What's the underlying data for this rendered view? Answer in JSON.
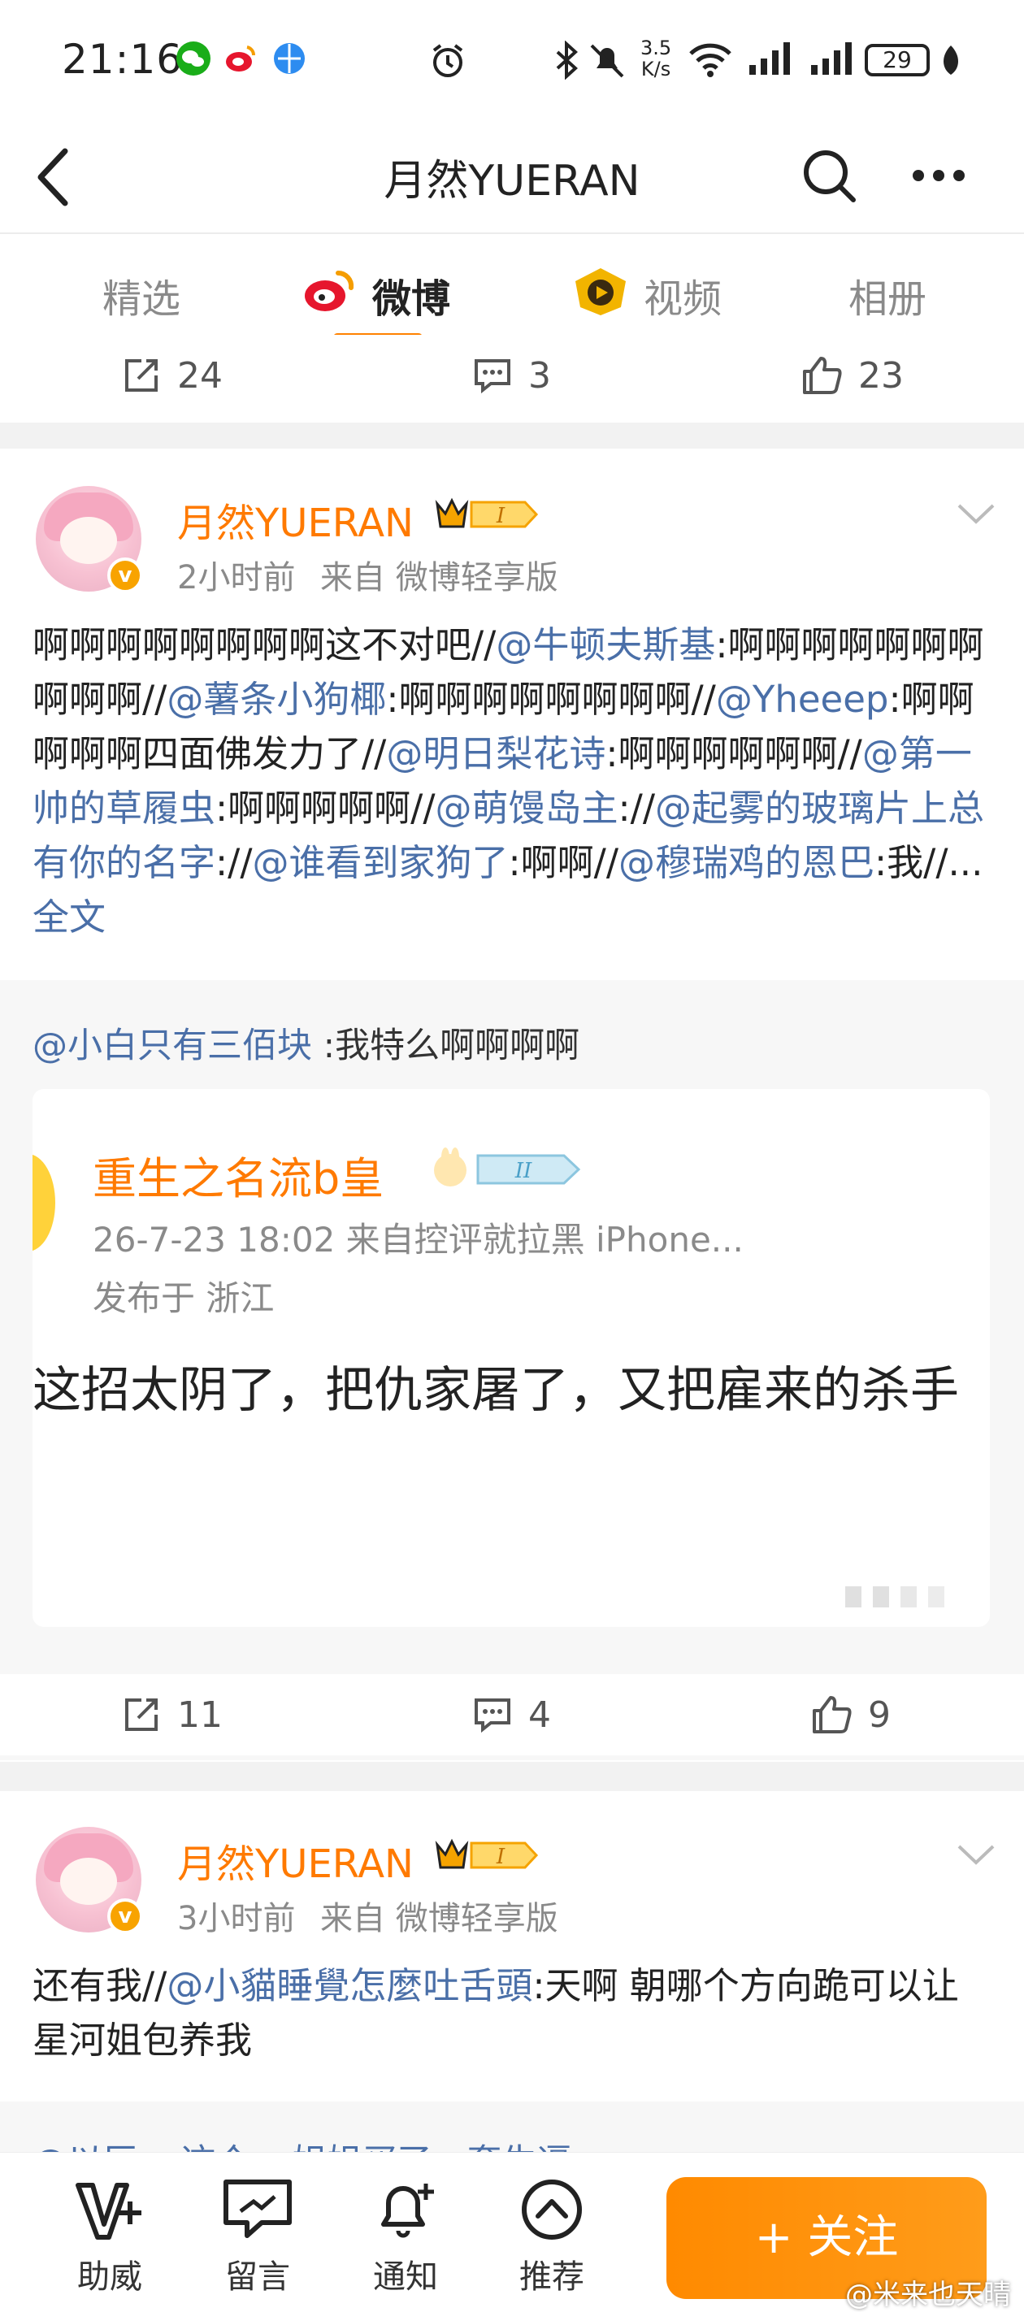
{
  "status": {
    "time": "21:16",
    "net_speed_top": "3.5",
    "net_speed_bottom": "K/s",
    "battery": "29"
  },
  "nav": {
    "title": "月然YUERAN"
  },
  "tabs": [
    {
      "label": "精选"
    },
    {
      "label": "微博"
    },
    {
      "label": "视频"
    },
    {
      "label": "相册"
    }
  ],
  "top_actions": {
    "repost": "24",
    "comment": "3",
    "like": "23"
  },
  "post1": {
    "author": "月然YUERAN",
    "level": "I",
    "time": "2小时前",
    "source": "来自 微博轻享版",
    "text_segments": [
      {
        "t": "啊啊啊啊啊啊啊啊这不对吧//",
        "link": false
      },
      {
        "t": "@牛顿夫斯基",
        "link": true
      },
      {
        "t": ":啊啊啊啊啊啊啊啊啊啊//",
        "link": false
      },
      {
        "t": "@薯条小狗椰",
        "link": true
      },
      {
        "t": ":啊啊啊啊啊啊啊啊//",
        "link": false
      },
      {
        "t": "@Yheeep",
        "link": true
      },
      {
        "t": ":啊啊啊啊啊四面佛发力了//",
        "link": false
      },
      {
        "t": "@明日梨花诗",
        "link": true
      },
      {
        "t": ":啊啊啊啊啊啊//",
        "link": false
      },
      {
        "t": "@第一帅的草履虫",
        "link": true
      },
      {
        "t": ":啊啊啊啊啊//",
        "link": false
      },
      {
        "t": "@萌馒岛主",
        "link": true
      },
      {
        "t": "://",
        "link": false
      },
      {
        "t": "@起雾的玻璃片上总有你的名字",
        "link": true
      },
      {
        "t": "://",
        "link": false
      },
      {
        "t": "@谁看到家狗了",
        "link": true
      },
      {
        "t": ":啊啊//",
        "link": false
      },
      {
        "t": "@穆瑞鸡的恩巴",
        "link": true
      },
      {
        "t": ":我//... ",
        "link": false
      },
      {
        "t": "全文",
        "link": true
      }
    ],
    "repost_user": "@小白只有三佰块",
    "repost_text": " :我特么啊啊啊啊",
    "card": {
      "name": "重生之名流b皇",
      "level": "II",
      "meta": "26-7-23 18:02  来自控评就拉黑 iPhone...",
      "location": "发布于 浙江",
      "quote": "这招太阴了，把仇家屠了，又把雇来的杀手"
    },
    "actions": {
      "repost": "11",
      "comment": "4",
      "like": "9"
    }
  },
  "post2": {
    "author": "月然YUERAN",
    "level": "I",
    "time": "3小时前",
    "source": "来自 微博轻享版",
    "text_segments": [
      {
        "t": "还有我//",
        "link": false
      },
      {
        "t": "@小貓睡覺怎麼吐舌頭",
        "link": true
      },
      {
        "t": ":天啊 朝哪个方向跪可以让星河姐包养我",
        "link": false
      }
    ],
    "repost_peek": "@以辰v :这个cp姐姐买了一套生逼"
  },
  "bottom": {
    "items": [
      {
        "label": "助威"
      },
      {
        "label": "留言"
      },
      {
        "label": "通知"
      },
      {
        "label": "推荐"
      }
    ],
    "follow": "+ 关注",
    "watermark": "@米来也天晴"
  }
}
